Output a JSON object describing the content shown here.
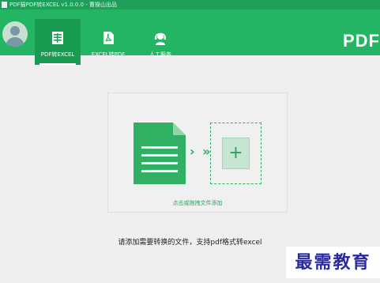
{
  "titlebar": {
    "title": "PDF猫PDF转EXCEL v1.0.0.0 - 曹操山出品"
  },
  "header": {
    "brand": "PDF",
    "tabs": [
      {
        "label": "PDF转EXCEL",
        "icon": "spreadsheet-icon",
        "active": true
      },
      {
        "label": "EXCEL转PDF",
        "icon": "pdf-icon",
        "active": false
      },
      {
        "label": "人工服务",
        "icon": "support-agent-icon",
        "active": false
      }
    ]
  },
  "main": {
    "arrows": "› »",
    "add_symbol": "+",
    "drop_hint": "点击或拖拽文件添加",
    "support_text": "请添加需要转换的文件，支持pdf格式转excel"
  },
  "watermark": "最需教育",
  "colors": {
    "brand_green": "#23b464",
    "active_tab": "#1a9b52",
    "accent_green": "#28b060"
  }
}
